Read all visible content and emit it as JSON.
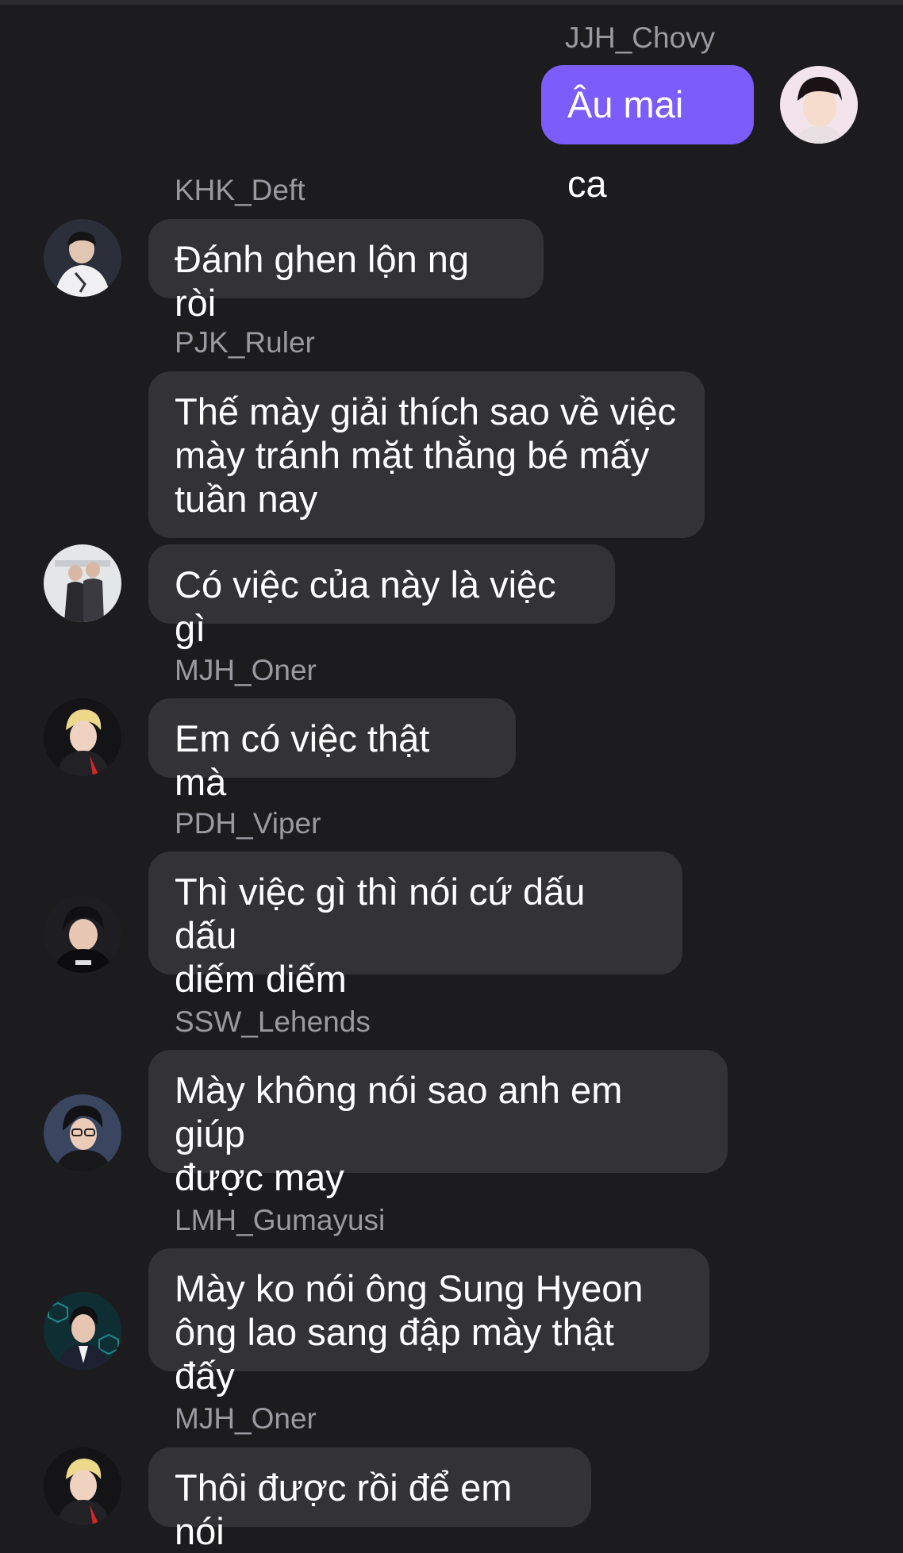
{
  "chat": {
    "outgoing": {
      "sender": "JJH_Chovy",
      "text": "Âu mai ca",
      "avatar_icon": "user-avatar-photo"
    },
    "messages": [
      {
        "sender": "KHK_Deft",
        "text": "Đánh ghen lộn ng ròi"
      },
      {
        "sender": "PJK_Ruler",
        "text": "Thế mày giải thích sao về việc\nmày tránh mặt thằng bé mấy\ntuần nay"
      },
      {
        "sender": "",
        "text": "Có việc của này là việc gì"
      },
      {
        "sender": "MJH_Oner",
        "text": "Em có việc thật mà"
      },
      {
        "sender": "PDH_Viper",
        "text": "Thì việc gì thì nói cứ dấu dấu\ndiếm diếm"
      },
      {
        "sender": "SSW_Lehends",
        "text": "Mày không nói sao anh em giúp\nđược may"
      },
      {
        "sender": "LMH_Gumayusi",
        "text": "Mày ko nói ông Sung Hyeon\nông lao sang đập mày thật đấy"
      },
      {
        "sender": "MJH_Oner",
        "text": "Thôi được rồi để em nói"
      }
    ]
  },
  "colors": {
    "background": "#1c1c1e",
    "incoming_bubble": "#333336",
    "outgoing_bubble": "#7c5cfa",
    "sender_name": "#9a9aa0"
  }
}
